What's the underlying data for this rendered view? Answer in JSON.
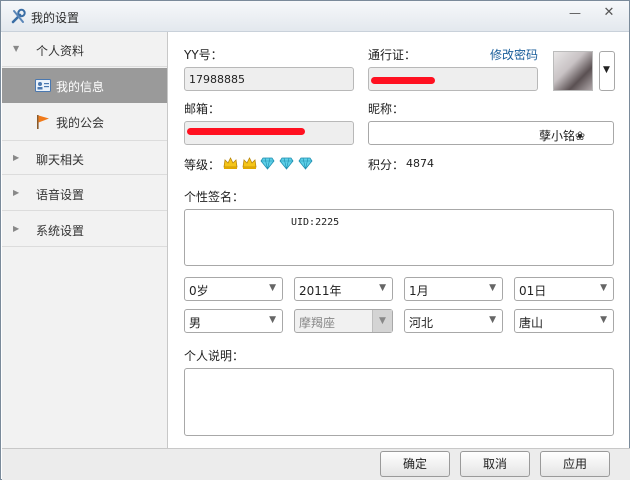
{
  "window": {
    "title": "我的设置",
    "icons": {
      "title": "wrench-screwdriver-icon",
      "minimize": "minimize-icon",
      "close": "close-icon"
    },
    "controls": {
      "minimize": "—",
      "close": "✕"
    }
  },
  "sidebar": {
    "groups": [
      {
        "label": "个人资料",
        "expanded": true,
        "icon": "triangle-down-icon",
        "glyph": "▼"
      },
      {
        "label": "聊天相关",
        "expanded": false,
        "icon": "triangle-right-icon",
        "glyph": "▶"
      },
      {
        "label": "语音设置",
        "expanded": false,
        "icon": "triangle-right-icon",
        "glyph": "▶"
      },
      {
        "label": "系统设置",
        "expanded": false,
        "icon": "triangle-right-icon",
        "glyph": "▶"
      }
    ],
    "sub_items": [
      {
        "label": "我的信息",
        "icon": "id-card-icon",
        "active": true
      },
      {
        "label": "我的公会",
        "icon": "flag-icon",
        "active": false
      }
    ]
  },
  "profile": {
    "yy_label": "YY号：",
    "yy_value": "17988885",
    "passport_label": "通行证：",
    "change_password": "修改密码",
    "email_label": "邮箱：",
    "nickname_label": "昵称：",
    "nickname_value": "孽小铭❀",
    "level_label": "等级：",
    "level_badges": [
      "crown-icon",
      "crown-icon",
      "diamond-icon",
      "diamond-icon",
      "diamond-icon"
    ],
    "points_label": "积分：",
    "points_value": "4874",
    "signature_label": "个性签名：",
    "signature_value": "UID:2225",
    "age": "0岁",
    "birth_year": "2011年",
    "birth_month": "1月",
    "birth_day": "01日",
    "gender": "男",
    "zodiac": "摩羯座",
    "province": "河北",
    "city": "唐山",
    "description_label": "个人说明：",
    "dropdown_glyph": "▼",
    "redacted_color": "#ff1020"
  },
  "footer": {
    "ok": "确定",
    "cancel": "取消",
    "apply": "应用"
  }
}
